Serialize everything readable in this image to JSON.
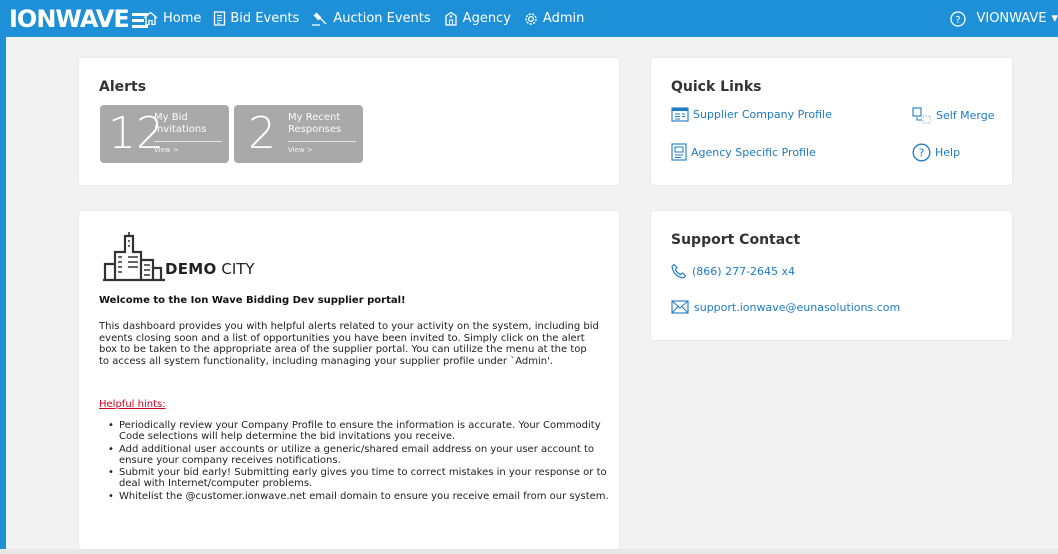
{
  "nav": {
    "logo_text": "IONWAVE",
    "items": [
      {
        "label": "Home",
        "icon": "home-icon"
      },
      {
        "label": "Bid Events",
        "icon": "document-icon"
      },
      {
        "label": "Auction Events",
        "icon": "gavel-icon"
      },
      {
        "label": "Agency",
        "icon": "building-icon"
      },
      {
        "label": "Admin",
        "icon": "gear-icon"
      }
    ],
    "user_label": "VIONWAVE",
    "brand_color": "#1e90d8"
  },
  "alerts": {
    "title": "Alerts",
    "tiles": [
      {
        "count": "12",
        "label_line1": "My Bid",
        "label_line2": "Invitations",
        "view": "View >"
      },
      {
        "count": "2",
        "label_line1": "My Recent",
        "label_line2": "Responses",
        "view": "View >"
      }
    ]
  },
  "quick_links": {
    "title": "Quick Links",
    "items": [
      {
        "label": "Supplier Company Profile",
        "icon": "company-profile-icon"
      },
      {
        "label": "Self Merge",
        "icon": "merge-icon"
      },
      {
        "label": "Agency Specific Profile",
        "icon": "agency-profile-icon"
      },
      {
        "label": "Help",
        "icon": "help-icon"
      }
    ]
  },
  "support": {
    "title": "Support Contact",
    "phone": "(866) 277-2645 x4",
    "email": "support.ionwave@eunasolutions.com"
  },
  "welcome": {
    "logo_bold": "DEMO",
    "logo_light": "CITY",
    "heading": "Welcome to the Ion Wave Bidding Dev supplier portal!",
    "intro": "This dashboard provides you with helpful alerts related to your activity on the system, including bid events closing soon and a list of opportunities you have been invited to. Simply click on the alert box to be taken to the appropriate area of the supplier portal. You can utilize the menu at the top to access all system functionality, including managing your supplier profile under `Admin'.",
    "hints_title": "Helpful hints:",
    "hints": [
      "Periodically review your Company Profile to ensure the information is accurate. Your Commodity Code selections will help determine the bid invitations you receive.",
      "Add additional user accounts or utilize a generic/shared email address on your user account to ensure your company receives notifications.",
      "Submit your bid early! Submitting early gives you time to correct mistakes in your response or to deal with Internet/computer problems.",
      "Whitelist the @customer.ionwave.net email domain to ensure you receive email from our system."
    ]
  }
}
